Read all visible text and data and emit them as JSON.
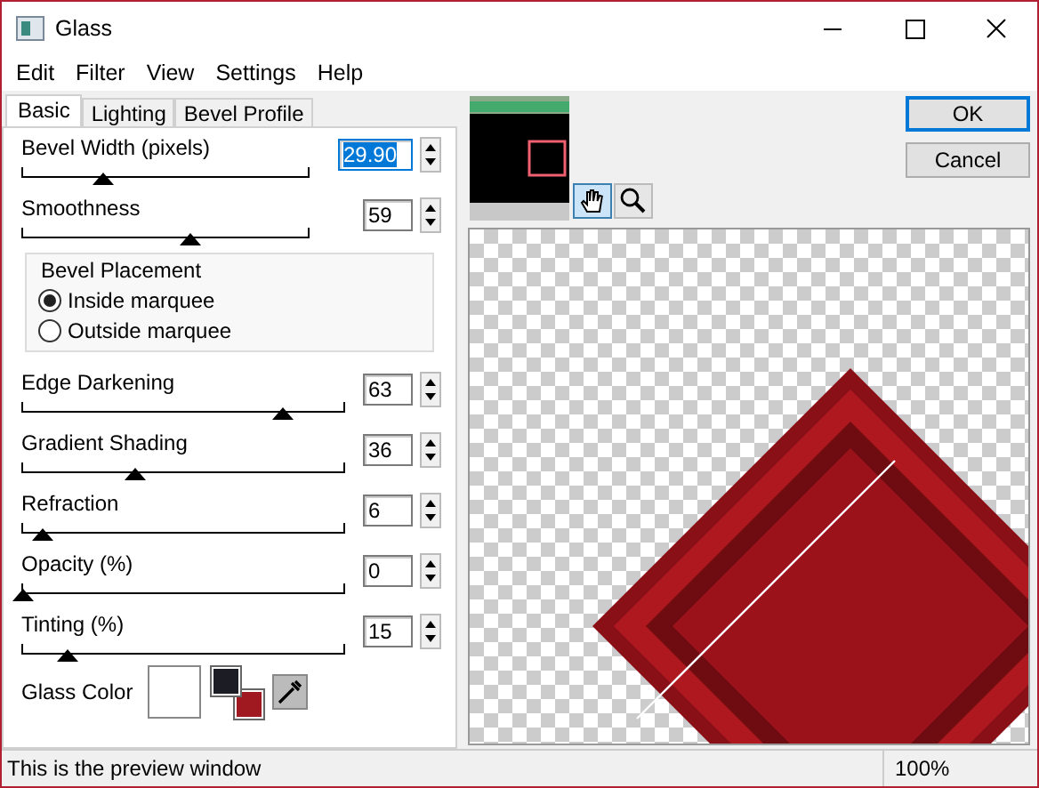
{
  "window": {
    "title": "Glass"
  },
  "menu": [
    "Edit",
    "Filter",
    "View",
    "Settings",
    "Help"
  ],
  "tabs": [
    {
      "label": "Basic",
      "selected": true
    },
    {
      "label": "Lighting",
      "selected": false
    },
    {
      "label": "Bevel Profile",
      "selected": false
    }
  ],
  "sliders_top": [
    {
      "label": "Bevel Width (pixels)",
      "value": "29.90",
      "level": 0.28,
      "focused": true
    },
    {
      "label": "Smoothness",
      "value": "59",
      "level": 0.59,
      "focused": false
    }
  ],
  "bevel_placement": {
    "title": "Bevel Placement",
    "options": [
      {
        "label": "Inside marquee",
        "selected": true
      },
      {
        "label": "Outside marquee",
        "selected": false
      }
    ]
  },
  "sliders_bottom": [
    {
      "label": "Edge Darkening",
      "value": "63",
      "level": 0.81,
      "focused": false
    },
    {
      "label": "Gradient Shading",
      "value": "36",
      "level": 0.35,
      "focused": false
    },
    {
      "label": "Refraction",
      "value": "6",
      "level": 0.06,
      "focused": false
    },
    {
      "label": "Opacity (%)",
      "value": "0",
      "level": 0,
      "focused": false
    },
    {
      "label": "Tinting (%)",
      "value": "15",
      "level": 0.14,
      "focused": false
    }
  ],
  "glass_color": {
    "label": "Glass Color",
    "color": "#ffffff",
    "swatches": [
      {
        "color": "#1c1c24"
      },
      {
        "color": "#a01820"
      }
    ]
  },
  "tools": [
    {
      "kind": "hand",
      "selected": true
    },
    {
      "kind": "zoom",
      "selected": false
    }
  ],
  "buttons": [
    {
      "label": "OK",
      "default": true
    },
    {
      "label": "Cancel",
      "default": false
    }
  ],
  "status_bar": {
    "text": "This is the preview window",
    "zoom": "100%"
  }
}
